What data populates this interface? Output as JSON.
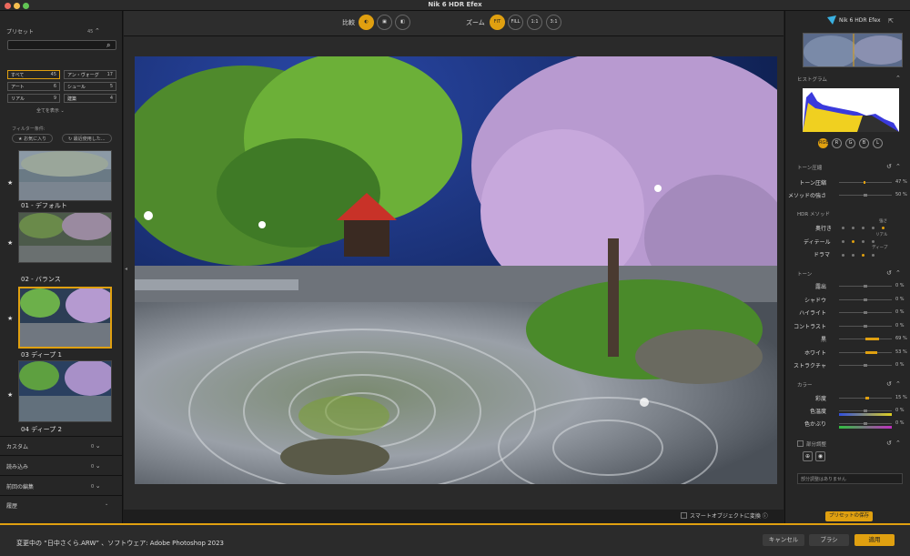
{
  "window": {
    "title": "Nik 6 HDR Efex"
  },
  "left": {
    "presets_label": "プリセット",
    "presets_count": "45",
    "search_placeholder": "",
    "categories": [
      {
        "label": "すべて",
        "count": "45"
      },
      {
        "label": "アン・ヴォーグ",
        "count": "17"
      },
      {
        "label": "アート",
        "count": "6"
      },
      {
        "label": "シュール",
        "count": "5"
      },
      {
        "label": "リアル",
        "count": "9"
      },
      {
        "label": "建築",
        "count": "4"
      }
    ],
    "show_all": "全てを表示",
    "filter_label": "フィルター条件:",
    "filter_favorites": "★ お気に入り",
    "filter_recent": "↻ 最近使用した...",
    "presets": [
      {
        "name": "01 - デフォルト"
      },
      {
        "name": "02 - バランス"
      },
      {
        "name": "03 ディープ 1"
      },
      {
        "name": "04 ディープ 2"
      }
    ],
    "sections": [
      {
        "label": "カスタム",
        "count": "0"
      },
      {
        "label": "読み込み",
        "count": "0"
      },
      {
        "label": "前回の編集",
        "count": "0"
      },
      {
        "label": "履歴",
        "count": ""
      }
    ]
  },
  "toolbar": {
    "compare_label": "比較",
    "zoom_label": "ズーム",
    "zoom_fit": "FIT",
    "zoom_fill": "FILL",
    "zoom_1_1": "1:1",
    "zoom_3_1": "3:1"
  },
  "canvas": {
    "smart_object_label": "スマートオブジェクトに変換"
  },
  "right": {
    "app_name": "Nik 6 HDR Efex",
    "histogram_label": "ヒストグラム",
    "channels": [
      "RGB",
      "R",
      "G",
      "B",
      "L"
    ],
    "tone_compression_label": "トーン圧縮",
    "tone_compression": {
      "label": "トーン圧縮",
      "value": "47 %",
      "level": 0.47
    },
    "method_strength": {
      "label": "メソッドの強さ",
      "value": "50 %",
      "level": 0.5
    },
    "hdr_method_label": "HDR メソッド",
    "method_rows": [
      "奥行き",
      "ディテール",
      "ドラマ"
    ],
    "method_tags": [
      "強さ",
      "リアル",
      "ディープ"
    ],
    "tone_label": "トーン",
    "tone_sliders": [
      {
        "label": "露出",
        "value": "0 %",
        "level": 0.5
      },
      {
        "label": "シャドウ",
        "value": "0 %",
        "level": 0.5
      },
      {
        "label": "ハイライト",
        "value": "0 %",
        "level": 0.5
      },
      {
        "label": "コントラスト",
        "value": "0 %",
        "level": 0.5
      },
      {
        "label": "黒",
        "value": "69 %",
        "level": 0.76
      },
      {
        "label": "ホワイト",
        "value": "53 %",
        "level": 0.72
      },
      {
        "label": "ストラクチャ",
        "value": "0 %",
        "level": 0.5
      }
    ],
    "color_label": "カラー",
    "color_sliders": [
      {
        "label": "彩度",
        "value": "15 %",
        "level": 0.57
      },
      {
        "label": "色温度",
        "value": "0 %",
        "level": 0.5
      },
      {
        "label": "色かぶり",
        "value": "0 %",
        "level": 0.5
      }
    ],
    "selective_label": "部分調整",
    "selective_empty": "部分調整はありません",
    "save_preset": "プリセットの保存"
  },
  "status": {
    "text": "変更中の “日中さくら.ARW” 、ソフトウェア: Adobe Photoshop 2023",
    "cancel": "キャンセル",
    "brush": "ブラシ",
    "apply": "適用"
  },
  "colors": {
    "accent": "#e0a010"
  }
}
